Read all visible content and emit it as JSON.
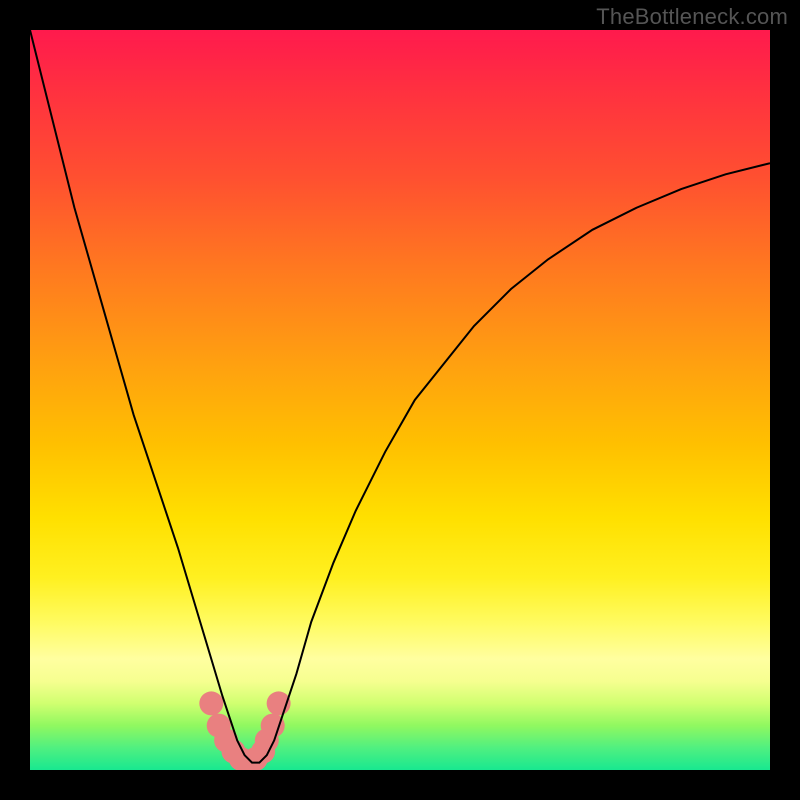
{
  "watermark": "TheBottleneck.com",
  "chart_data": {
    "type": "line",
    "title": "",
    "xlabel": "",
    "ylabel": "",
    "xlim": [
      0,
      100
    ],
    "ylim": [
      0,
      100
    ],
    "gradient_stops": [
      {
        "pct": 0,
        "color": "#ff1a4d"
      },
      {
        "pct": 8,
        "color": "#ff3040"
      },
      {
        "pct": 20,
        "color": "#ff5030"
      },
      {
        "pct": 32,
        "color": "#ff7820"
      },
      {
        "pct": 45,
        "color": "#ffa010"
      },
      {
        "pct": 56,
        "color": "#ffc000"
      },
      {
        "pct": 66,
        "color": "#ffe000"
      },
      {
        "pct": 74,
        "color": "#fff020"
      },
      {
        "pct": 80,
        "color": "#fffb60"
      },
      {
        "pct": 85,
        "color": "#ffffa0"
      },
      {
        "pct": 88,
        "color": "#f6ff90"
      },
      {
        "pct": 91,
        "color": "#d0ff70"
      },
      {
        "pct": 94,
        "color": "#90f860"
      },
      {
        "pct": 97,
        "color": "#50f080"
      },
      {
        "pct": 100,
        "color": "#18e890"
      }
    ],
    "series": [
      {
        "name": "bottleneck-curve",
        "color": "#000000",
        "x": [
          0.0,
          2.0,
          4.0,
          6.0,
          8.0,
          10.0,
          12.0,
          14.0,
          16.0,
          18.0,
          20.0,
          21.5,
          23.0,
          24.5,
          26.0,
          27.0,
          28.0,
          29.0,
          30.0,
          31.0,
          32.0,
          33.0,
          34.0,
          36.0,
          38.0,
          41.0,
          44.0,
          48.0,
          52.0,
          56.0,
          60.0,
          65.0,
          70.0,
          76.0,
          82.0,
          88.0,
          94.0,
          100.0
        ],
        "y": [
          100.0,
          92.0,
          84.0,
          76.0,
          69.0,
          62.0,
          55.0,
          48.0,
          42.0,
          36.0,
          30.0,
          25.0,
          20.0,
          15.0,
          10.0,
          7.0,
          4.0,
          2.0,
          1.0,
          1.0,
          2.0,
          4.0,
          7.0,
          13.0,
          20.0,
          28.0,
          35.0,
          43.0,
          50.0,
          55.0,
          60.0,
          65.0,
          69.0,
          73.0,
          76.0,
          78.5,
          80.5,
          82.0
        ]
      }
    ],
    "markers": {
      "name": "trough-dots",
      "color": "#e98080",
      "radius": 12,
      "x": [
        24.5,
        25.5,
        26.5,
        27.5,
        28.5,
        29.5,
        30.5,
        31.5,
        32.0,
        32.8,
        33.6
      ],
      "y": [
        9.0,
        6.0,
        4.0,
        2.5,
        1.5,
        1.0,
        1.5,
        2.5,
        4.0,
        6.0,
        9.0
      ]
    }
  }
}
